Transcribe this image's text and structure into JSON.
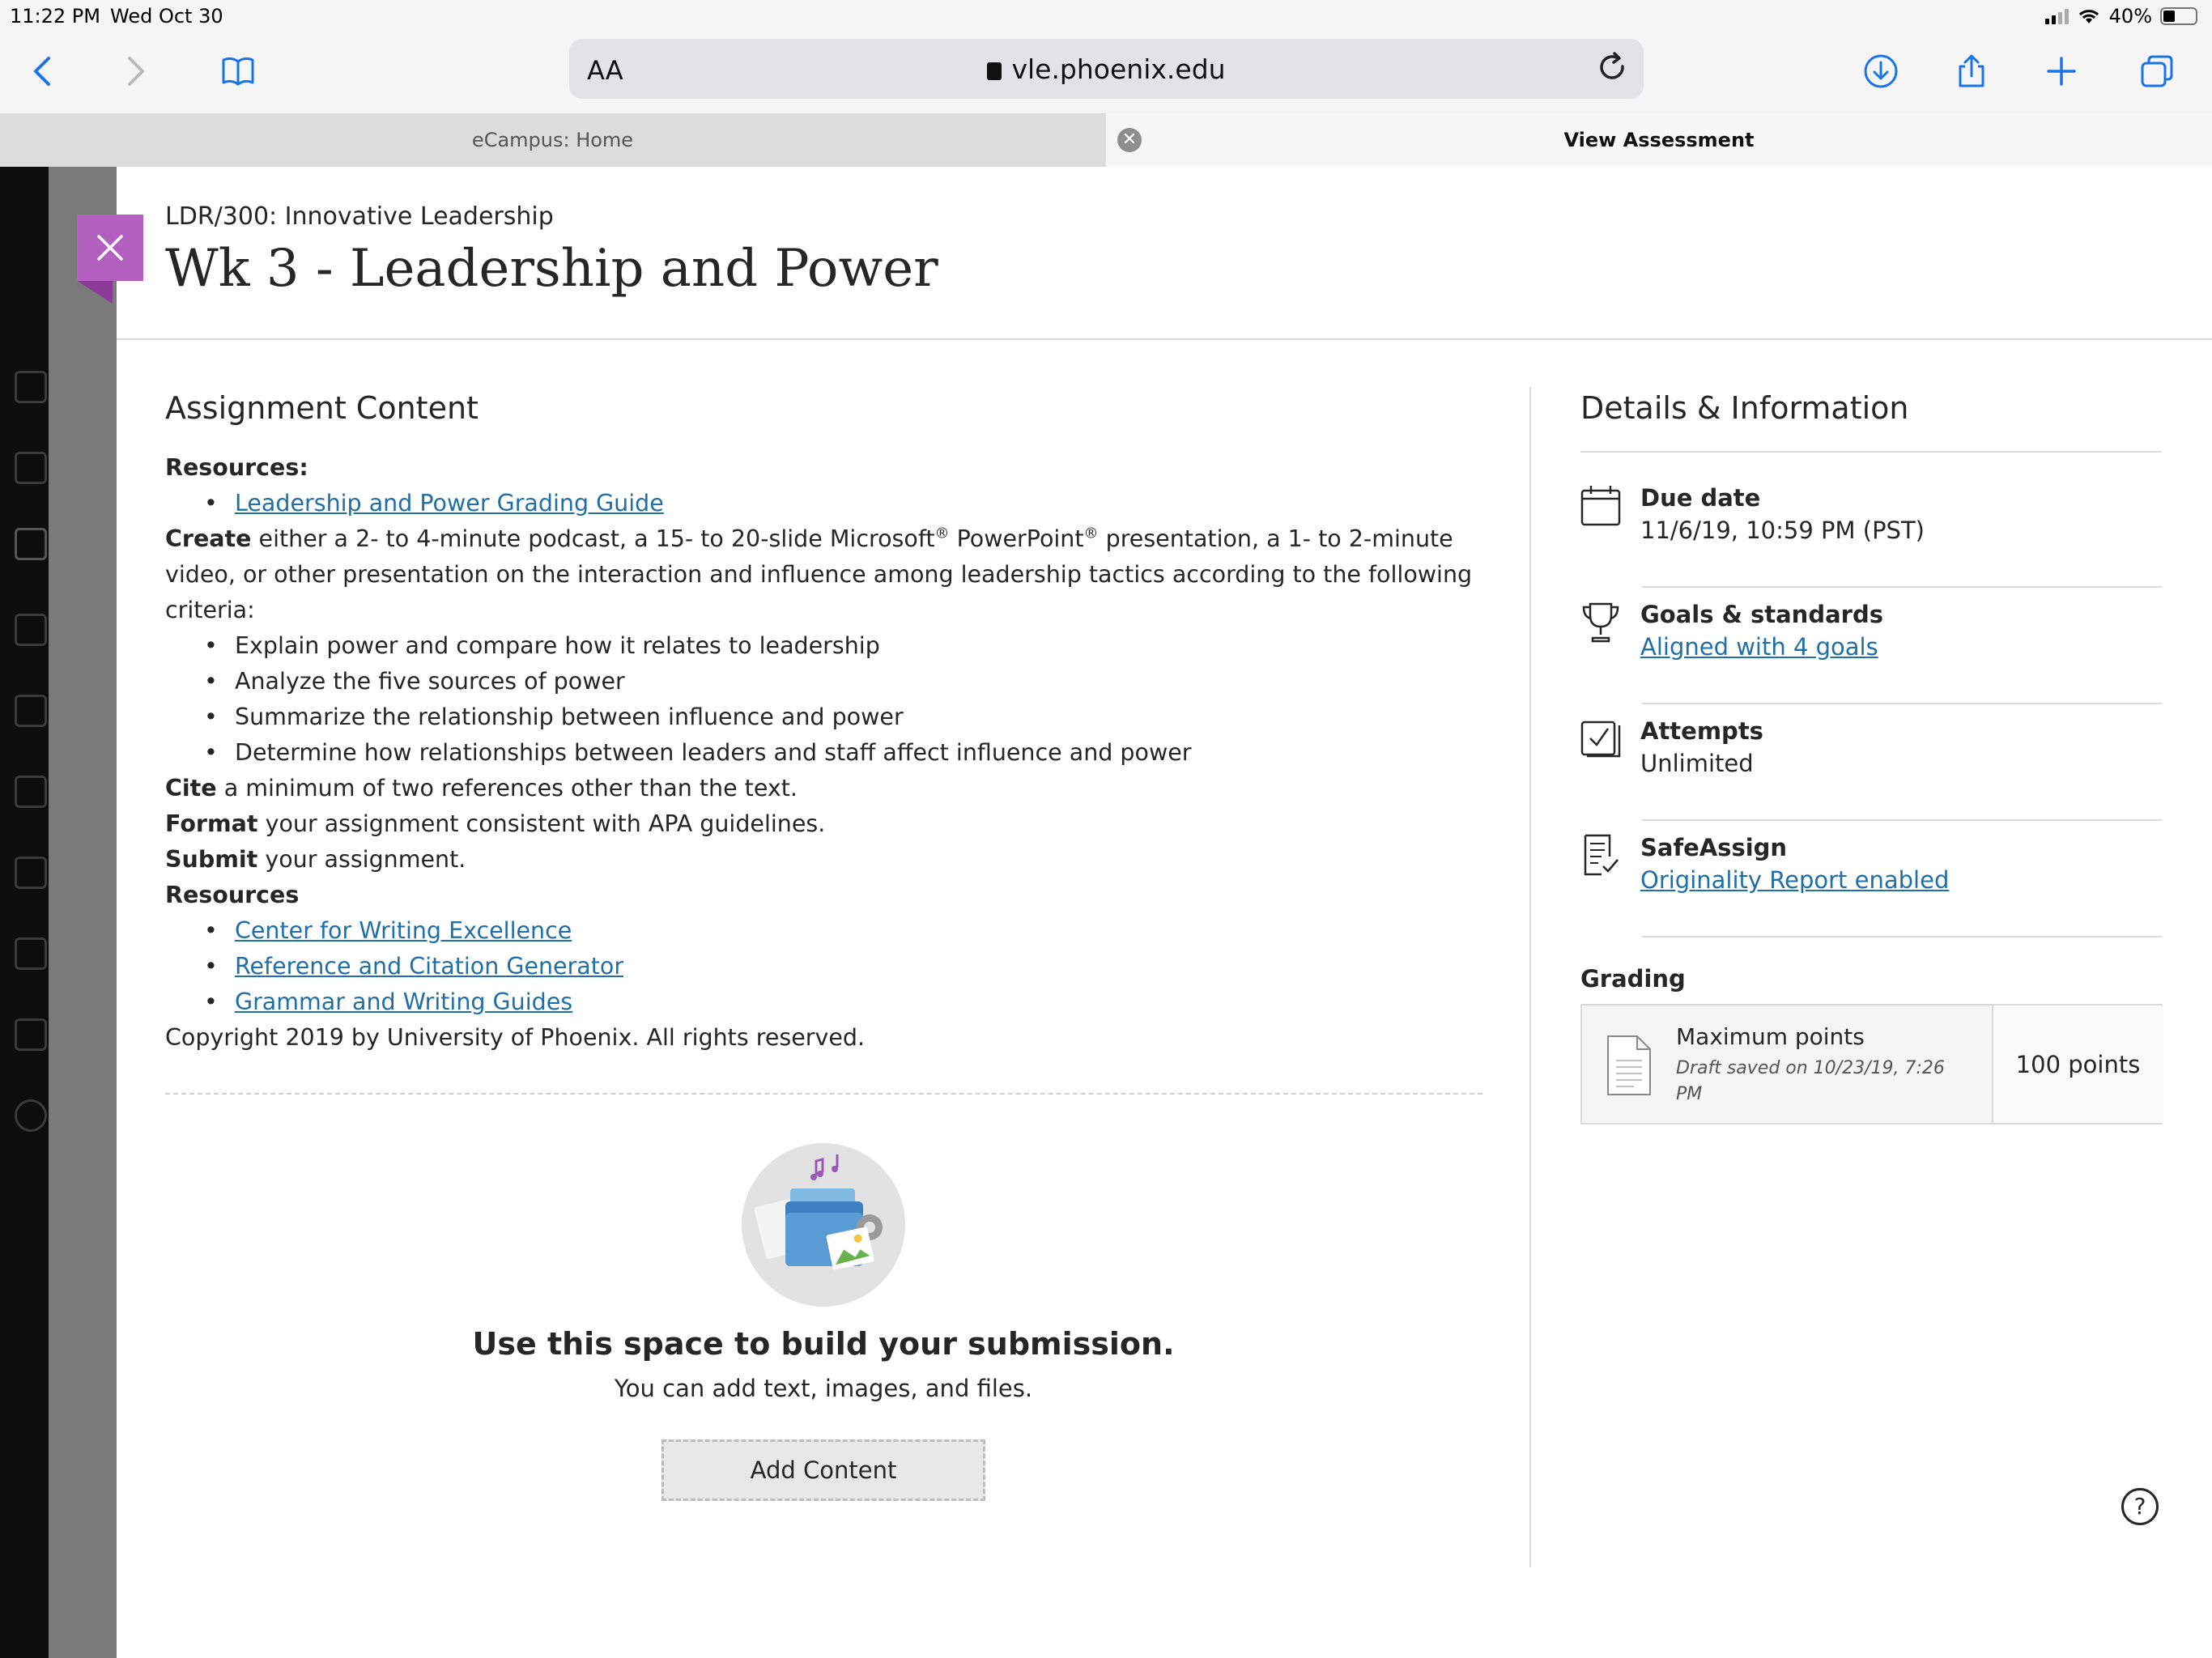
{
  "status_bar": {
    "time": "11:22 PM",
    "date": "Wed Oct 30",
    "battery": "40%"
  },
  "browser": {
    "text_size_label": "AA",
    "url": "vle.phoenix.edu",
    "tabs": [
      {
        "label": "eCampus: Home",
        "active": false
      },
      {
        "label": "View Assessment",
        "active": true
      }
    ],
    "tab_close_glyph": "✕"
  },
  "header": {
    "course": "LDR/300: Innovative Leadership",
    "title": "Wk 3 - Leadership and Power",
    "close_icon": "close-icon"
  },
  "assignment": {
    "heading": "Assignment Content",
    "resources_label": "Resources:",
    "grading_guide_link": "Leadership and Power Grading Guide",
    "create_label": "Create",
    "create_text_1": " either a 2- to 4-minute podcast, a 15- to 20-slide Microsoft",
    "create_text_2": " PowerPoint",
    "create_text_3": " presentation, a 1- to 2-minute video, or other presentation on the interaction and influence among leadership tactics according to the following criteria:",
    "registered_mark": "®",
    "criteria": [
      "Explain power and compare how it relates to leadership",
      "Analyze the five sources of power",
      "Summarize the relationship between influence and power",
      "Determine how relationships between leaders and staff affect influence and power"
    ],
    "cite_label": "Cite",
    "cite_text": " a minimum of two references other than the text.",
    "format_label": "Format",
    "format_text": " your assignment consistent with APA guidelines.",
    "submit_label": "Submit",
    "submit_text": " your assignment.",
    "resources2_label": "Resources",
    "resource_links": [
      "Center for Writing Excellence",
      "Reference and Citation Generator",
      "Grammar and Writing Guides"
    ],
    "copyright": "Copyright 2019 by University of Phoenix. All rights reserved."
  },
  "submission": {
    "title": "Use this space to build your submission.",
    "subtitle": "You can add text, images, and files.",
    "add_button": "Add Content"
  },
  "details": {
    "heading": "Details & Information",
    "items": [
      {
        "label": "Due date",
        "value": "11/6/19, 10:59 PM (PST)",
        "icon": "calendar-icon",
        "is_link": false
      },
      {
        "label": "Goals & standards",
        "value": "Aligned with 4 goals",
        "icon": "trophy-icon",
        "is_link": true
      },
      {
        "label": "Attempts",
        "value": "Unlimited",
        "icon": "checkbox-icon",
        "is_link": false
      },
      {
        "label": "SafeAssign",
        "value": "Originality Report enabled",
        "icon": "document-check-icon",
        "is_link": true
      }
    ],
    "grading_label": "Grading",
    "grading": {
      "name": "Maximum points",
      "draft": "Draft saved on 10/23/19, 7:26 PM",
      "points": "100 points"
    },
    "help_glyph": "?"
  },
  "colors": {
    "accent_purple": "#b35fbf",
    "link_blue": "#1f6fa8",
    "safari_blue": "#1a73e8"
  }
}
